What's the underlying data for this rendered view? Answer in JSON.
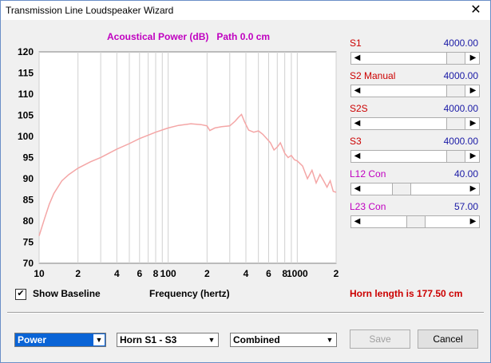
{
  "window": {
    "title": "Transmission Line Loudspeaker Wizard",
    "close_glyph": "✕"
  },
  "plot": {
    "title": "Acoustical Power (dB)   Path 0.0 cm"
  },
  "chart_data": {
    "type": "line",
    "title": "Acoustical Power (dB)   Path 0.0 cm",
    "xlabel": "Frequency (hertz)",
    "ylabel": "",
    "x_scale": "log",
    "xlim": [
      10,
      2000
    ],
    "ylim": [
      70,
      120
    ],
    "yticks": [
      "70",
      "75",
      "80",
      "85",
      "90",
      "95",
      "100",
      "105",
      "110",
      "115",
      "120"
    ],
    "xticks": [
      "10",
      "2",
      "4",
      "6",
      "8",
      "100",
      "2",
      "4",
      "6",
      "8",
      "1000",
      "2"
    ],
    "grid": true,
    "line_color": "#f4a6a6",
    "series": [
      {
        "x": [
          10,
          11,
          12,
          13,
          15,
          17,
          20,
          25,
          30,
          40,
          50,
          60,
          70,
          80,
          100,
          120,
          150,
          180,
          200,
          210,
          230,
          260,
          300,
          330,
          350,
          370,
          390,
          420,
          460,
          500,
          540,
          580,
          620,
          660,
          700,
          740,
          800,
          850,
          900,
          950,
          1000,
          1100,
          1200,
          1300,
          1400,
          1500,
          1600,
          1700,
          1800,
          1900,
          2000
        ],
        "y": [
          76.5,
          80.5,
          84,
          86.5,
          89.5,
          91,
          92.5,
          94,
          95,
          97,
          98.3,
          99.5,
          100.3,
          101,
          102,
          102.6,
          103,
          102.8,
          102.5,
          101.4,
          102,
          102.3,
          102.5,
          103.6,
          104.5,
          105.2,
          103.5,
          101.5,
          101,
          101.3,
          100.5,
          99.5,
          98.5,
          96.8,
          97.5,
          98.5,
          96,
          95,
          95.5,
          94.5,
          94.2,
          93,
          90,
          92,
          89,
          91,
          89.5,
          88,
          89.5,
          87,
          86.8
        ]
      }
    ]
  },
  "sliders": [
    {
      "label": "S1",
      "value": "4000.00",
      "color": "#cc0000"
    },
    {
      "label": "S2 Manual",
      "value": "4000.00",
      "color": "#cc0000"
    },
    {
      "label": "S2S",
      "value": "4000.00",
      "color": "#cc0000"
    },
    {
      "label": "S3",
      "value": "4000.00",
      "color": "#cc0000"
    },
    {
      "label": "L12  Con",
      "value": "40.00",
      "color": "#c000c0"
    },
    {
      "label": "L23  Con",
      "value": "57.00",
      "color": "#c000c0"
    }
  ],
  "baseline": {
    "label": "Show Baseline",
    "checked_glyph": "✔"
  },
  "frequency_label": "Frequency (hertz)",
  "horn_length": {
    "text": "Horn length is 177.50 cm",
    "color": "#cc0000"
  },
  "controls": {
    "mode_select": "Power",
    "horn_select": "Horn S1 - S3",
    "combine_select": "Combined",
    "save_label": "Save",
    "cancel_label": "Cancel"
  }
}
